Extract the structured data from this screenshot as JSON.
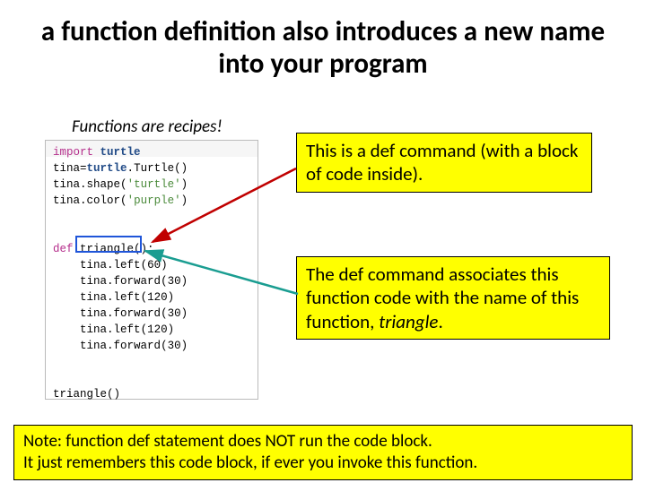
{
  "title": "a function definition also introduces a new name into your program",
  "subtitle": "Functions are recipes!",
  "code": {
    "l1a": "import",
    "l1b": "turtle",
    "l2a": "tina",
    "l2b": "turtle",
    "l2c": "Turtle",
    "l3a": "tina",
    "l3b": "shape",
    "l3c": "'turtle'",
    "l4a": "tina",
    "l4b": "color",
    "l4c": "'purple'",
    "l5a": "def",
    "l5b": "triangle",
    "l6a": "tina",
    "l6b": "left",
    "l6c": "60",
    "l7a": "tina",
    "l7b": "forward",
    "l7c": "30",
    "l8a": "tina",
    "l8b": "left",
    "l8c": "120",
    "l9a": "tina",
    "l9b": "forward",
    "l9c": "30",
    "l10a": "tina",
    "l10b": "left",
    "l10c": "120",
    "l11a": "tina",
    "l11b": "forward",
    "l11c": "30",
    "l12a": "triangle"
  },
  "callout1": "This is a def command (with a block of code inside).",
  "callout2_pre": "The def command associates this function code with the name of this function, ",
  "callout2_name": "triangle",
  "callout2_post": ".",
  "note_l1": "Note: function def statement does NOT run the code block.",
  "note_l2": "It just remembers this code block, if ever you invoke this function."
}
